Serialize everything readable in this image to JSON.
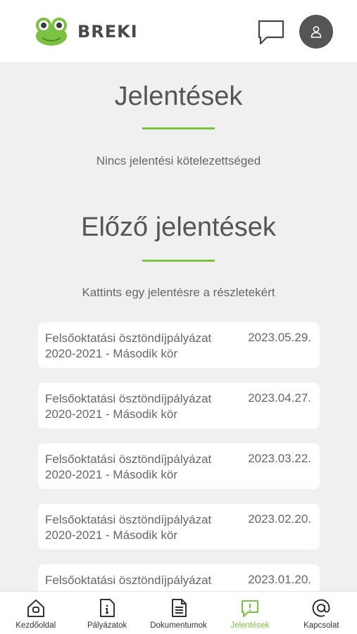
{
  "brand": {
    "name": "BREKI"
  },
  "colors": {
    "accent": "#7cc242",
    "avatar_bg": "#555555"
  },
  "header": {
    "chat_icon": "chat-bubble-icon",
    "profile_icon": "user-icon"
  },
  "main": {
    "title": "Jelentések",
    "no_report_text": "Nincs jelentési kötelezettséged",
    "previous_title": "Előző jelentések",
    "previous_hint": "Kattints egy jelentésre a részletekért",
    "reports": [
      {
        "title": "Felsőoktatási ösztöndíjpályázat 2020-2021 - Második kör",
        "date": "2023.05.29."
      },
      {
        "title": "Felsőoktatási ösztöndíjpályázat 2020-2021 - Második kör",
        "date": "2023.04.27."
      },
      {
        "title": "Felsőoktatási ösztöndíjpályázat 2020-2021 - Második kör",
        "date": "2023.03.22."
      },
      {
        "title": "Felsőoktatási ösztöndíjpályázat 2020-2021 - Második kör",
        "date": "2023.02.20."
      },
      {
        "title": "Felsőoktatási ösztöndíjpályázat",
        "date": "2023.01.20."
      }
    ]
  },
  "tabbar": {
    "items": [
      {
        "label": "Kezdőoldal",
        "icon": "home-icon"
      },
      {
        "label": "Pályázatok",
        "icon": "document-info-icon"
      },
      {
        "label": "Dokumentumok",
        "icon": "document-lines-icon"
      },
      {
        "label": "Jelentések",
        "icon": "report-alert-icon",
        "active": true
      },
      {
        "label": "Kapcsolat",
        "icon": "at-sign-icon"
      }
    ]
  }
}
